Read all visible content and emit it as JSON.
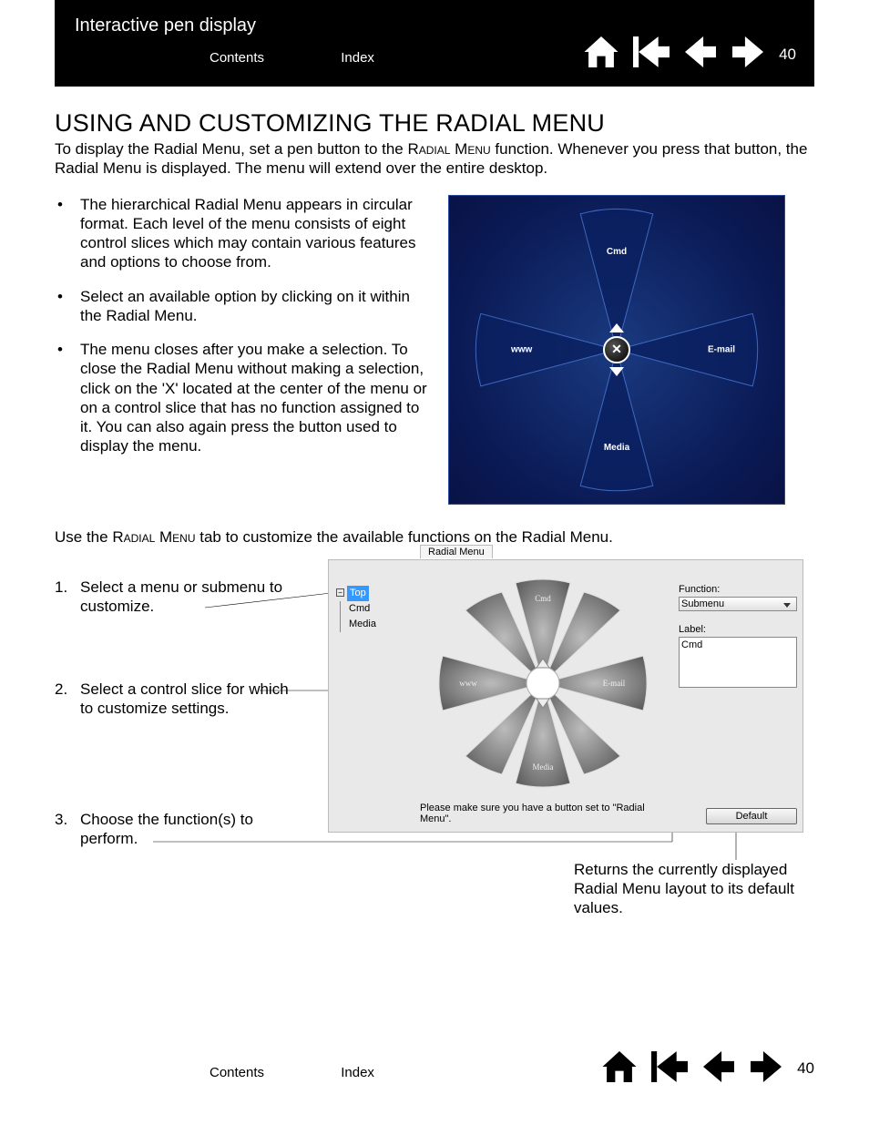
{
  "header": {
    "title": "Interactive pen display",
    "contents_label": "Contents",
    "index_label": "Index",
    "page_number": "40"
  },
  "section": {
    "heading": "USING AND CUSTOMIZING THE RADIAL MENU",
    "intro_a": "To display the Radial Menu, set a pen button to the ",
    "intro_sc": "Radial Menu",
    "intro_b": " function.  Whenever you press that button, the Radial Menu is displayed.  The menu will extend over the entire desktop."
  },
  "bullets": [
    "The hierarchical Radial Menu appears in circular format.  Each level of the menu consists of eight control slices which may contain various features and options to choose from.",
    "Select an available option by clicking on it within the Radial Menu.",
    "The menu closes after you make a selection.  To close the Radial Menu without making a selection, click on the 'X' located at the center of the menu or on a control slice that has no function assigned to it.  You can also again press the button used to display the menu."
  ],
  "radial_preview": {
    "cmd": "Cmd",
    "www": "www",
    "email": "E-mail",
    "media": "Media"
  },
  "midpara_a": "Use the ",
  "midpara_sc": "Radial Menu",
  "midpara_b": " tab to customize the available functions on the Radial Menu.",
  "steps": [
    "Select a menu or submenu to customize.",
    "Select a control slice for which to customize settings.",
    "Choose the function(s) to perform."
  ],
  "panel": {
    "tab_label": "Radial Menu",
    "tree_top": "Top",
    "tree_children": [
      "Cmd",
      "Media"
    ],
    "ring": {
      "cmd": "Cmd",
      "www": "www",
      "email": "E-mail",
      "media": "Media"
    },
    "hint": "Please make sure you have a button set to \"Radial Menu\".",
    "function_label": "Function:",
    "function_value": "Submenu",
    "label_label": "Label:",
    "label_value": "Cmd",
    "default_btn": "Default"
  },
  "default_desc": "Returns the currently displayed Radial Menu layout to its default values.",
  "footer": {
    "contents_label": "Contents",
    "index_label": "Index",
    "page_number": "40"
  }
}
